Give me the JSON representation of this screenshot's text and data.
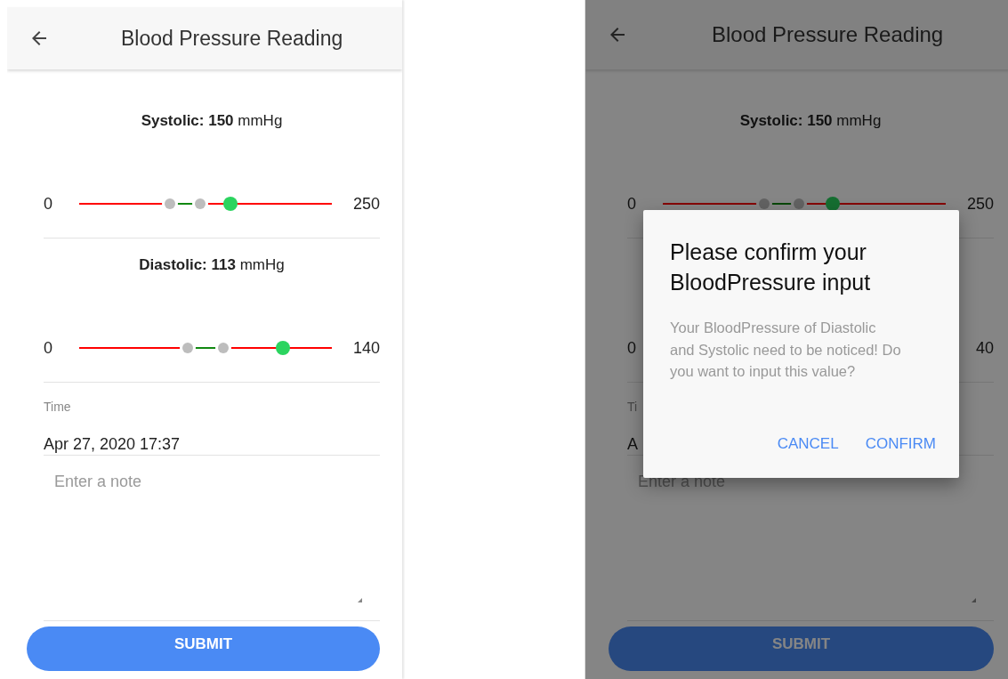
{
  "screens": [
    {
      "title": "Blood Pressure Reading",
      "dimmed": false,
      "readings": [
        {
          "name": "Systolic:",
          "value": "150",
          "unit": "mmHg",
          "min": "0",
          "max": "250",
          "level": 0.6,
          "range_handles": [
            {
              "level": 0.36
            },
            {
              "level": 0.48
            }
          ]
        },
        {
          "name": "Diastolic:",
          "value": "113",
          "unit": "mmHg",
          "min": "0",
          "max": "140",
          "level": 0.807,
          "range_handles": [
            {
              "level": 0.43
            },
            {
              "level": 0.57
            }
          ]
        }
      ],
      "time": {
        "label": "Time",
        "value": "Apr 27, 2020 17:37"
      },
      "note": {
        "placeholder": "Enter a note"
      },
      "submit": "SUBMIT"
    },
    {
      "title": "Blood Pressure Reading",
      "dimmed": true,
      "readings": [
        {
          "name": "Systolic:",
          "value": "150",
          "unit": "mmHg",
          "min": "0",
          "max": "250",
          "level": 0.6,
          "range_handles": [
            {
              "level": 0.36
            },
            {
              "level": 0.48
            }
          ]
        },
        {
          "min": "0",
          "max": "40"
        }
      ],
      "time": {
        "label": "Ti",
        "value": "A"
      },
      "note": {
        "placeholder": "Enter a note"
      },
      "submit": "SUBMIT",
      "dialog": {
        "title": "Please confirm your BloodPressure input",
        "message": "Your BloodPressure of Diastolic and Systolic need to be noticed! Do you want to input this value?",
        "buttons": [
          "CANCEL",
          "CONFIRM"
        ]
      }
    }
  ]
}
